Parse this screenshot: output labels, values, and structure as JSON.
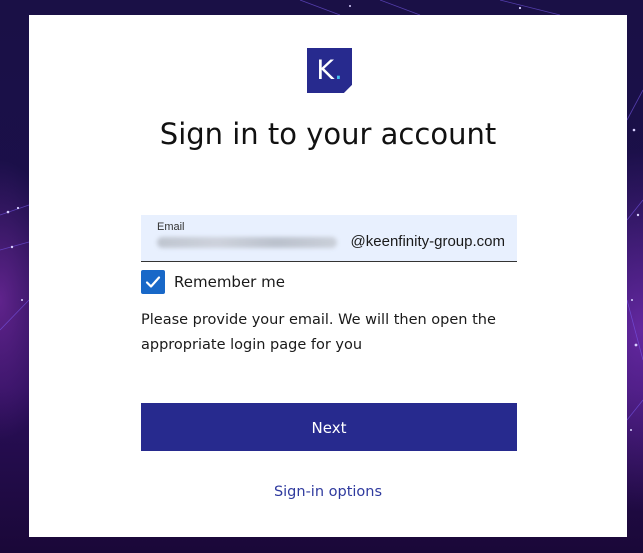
{
  "logo": {
    "letter": "K",
    "dot": ".",
    "colors": {
      "background": "#272a8e",
      "dot": "#40c0f0"
    }
  },
  "title": "Sign in to your account",
  "email": {
    "label": "Email",
    "domain": "@keenfinity-group.com"
  },
  "remember": {
    "label": "Remember me",
    "checked": true
  },
  "description": "Please provide your email. We will then open the appropriate login page for you",
  "next_button": "Next",
  "signin_options": "Sign-in options",
  "colors": {
    "primary": "#272a8e",
    "checkbox": "#1868c8",
    "link": "#2f3a9e",
    "field_background": "#e8f0fe"
  }
}
